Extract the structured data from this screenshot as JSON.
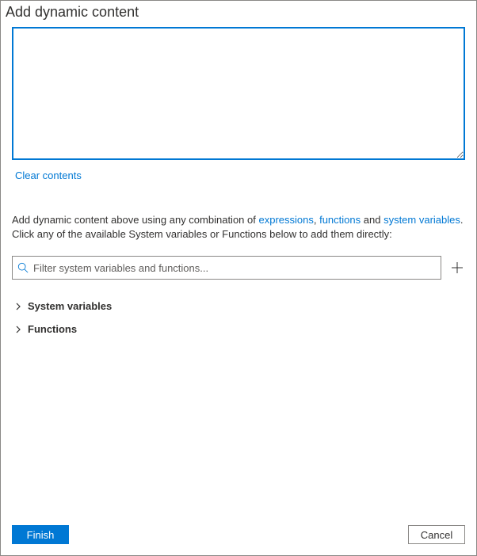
{
  "title": "Add dynamic content",
  "editor": {
    "value": "",
    "clear_label": "Clear contents"
  },
  "help": {
    "prefix": "Add dynamic content above using any combination of ",
    "link_expressions": "expressions",
    "sep1": ", ",
    "link_functions": "functions",
    "sep2": " and ",
    "link_sysvars": "system variables",
    "suffix": ". Click any of the available System variables or Functions below to add them directly:"
  },
  "filter": {
    "placeholder": "Filter system variables and functions..."
  },
  "tree": {
    "system_variables": "System variables",
    "functions": "Functions"
  },
  "buttons": {
    "finish": "Finish",
    "cancel": "Cancel"
  },
  "colors": {
    "accent": "#0078d4",
    "border": "#8a8886",
    "text": "#323130"
  }
}
